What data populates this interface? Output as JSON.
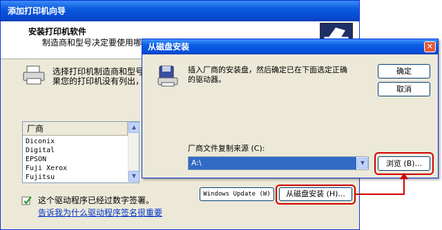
{
  "wizard": {
    "title": "添加打印机向导",
    "header_title": "安装打印机软件",
    "header_subtitle": "制造商和型号决定要使用哪个打印机软件。",
    "description_line1": "选择打印机制造商和型号",
    "description_line2": "果您的打印机没有列出，",
    "manufacturer_list": {
      "header": "厂商",
      "items": [
        "Diconix",
        "Digital",
        "EPSON",
        "Fuji Xerox",
        "Fujitsu"
      ]
    },
    "windows_update_button": "Windows Update (W)",
    "have_disk_button": "从磁盘安装 (H)...",
    "signature_text": "这个驱动程序已经过数字签署。",
    "signature_link": "告诉我为什么驱动程序签名很重要"
  },
  "dialog": {
    "title": "从磁盘安装",
    "close_glyph": "✕",
    "message_line1": "插入厂商的安装盘，然后确定已在下面选定正确",
    "message_line2": "的驱动器。",
    "ok_button": "确定",
    "cancel_button": "取消",
    "copy_source_label": "厂商文件复制来源 (C):",
    "copy_source_value": "A:\\",
    "browse_button": "浏览 (B)..."
  },
  "colors": {
    "annotation_red": "#d00000",
    "titlebar_blue": "#0a5ce3",
    "window_face": "#ece9d8",
    "link_blue": "#0033cc"
  },
  "icons": {
    "printer": "printer-icon",
    "floppy_install": "install-disk-icon",
    "signature": "digital-signature-icon",
    "scroll_up": "scroll-up-arrow-icon",
    "scroll_down": "scroll-down-arrow-icon",
    "dropdown": "chevron-down-icon"
  }
}
